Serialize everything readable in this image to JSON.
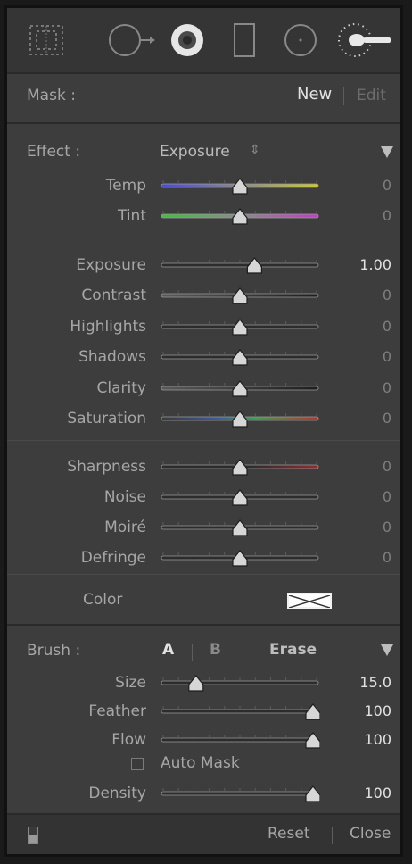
{
  "mask": {
    "label": "Mask :",
    "new_label": "New",
    "edit_label": "Edit"
  },
  "effect": {
    "label": "Effect :",
    "value": "Exposure",
    "arrows": "⇕",
    "sliders": [
      {
        "label": "Temp",
        "value": "0",
        "position": 0.5,
        "track": "temp"
      },
      {
        "label": "Tint",
        "value": "0",
        "position": 0.5,
        "track": "tint"
      }
    ]
  },
  "adjustments": [
    {
      "label": "Exposure",
      "value": "1.00",
      "position": 0.6,
      "track": "grey",
      "active": true
    },
    {
      "label": "Contrast",
      "value": "0",
      "position": 0.5,
      "track": "contrast"
    },
    {
      "label": "Highlights",
      "value": "0",
      "position": 0.5,
      "track": "grey"
    },
    {
      "label": "Shadows",
      "value": "0",
      "position": 0.5,
      "track": "grey"
    },
    {
      "label": "Clarity",
      "value": "0",
      "position": 0.5,
      "track": "contrast"
    },
    {
      "label": "Saturation",
      "value": "0",
      "position": 0.5,
      "track": "saturation"
    }
  ],
  "detail": [
    {
      "label": "Sharpness",
      "value": "0",
      "position": 0.5,
      "track": "sharpness"
    },
    {
      "label": "Noise",
      "value": "0",
      "position": 0.5,
      "track": "grey"
    },
    {
      "label": "Moiré",
      "value": "0",
      "position": 0.5,
      "track": "grey"
    },
    {
      "label": "Defringe",
      "value": "0",
      "position": 0.5,
      "track": "grey"
    }
  ],
  "color": {
    "label": "Color"
  },
  "brush": {
    "label": "Brush :",
    "a_label": "A",
    "b_label": "B",
    "erase_label": "Erase",
    "sliders": [
      {
        "label": "Size",
        "value": "15.0",
        "position": 0.2,
        "track": "grey"
      },
      {
        "label": "Feather",
        "value": "100",
        "position": 1.0,
        "track": "grey"
      },
      {
        "label": "Flow",
        "value": "100",
        "position": 1.0,
        "track": "grey"
      }
    ],
    "auto_mask_label": "Auto Mask",
    "density": {
      "label": "Density",
      "value": "100",
      "position": 1.0,
      "track": "grey"
    }
  },
  "footer": {
    "reset_label": "Reset",
    "close_label": "Close"
  },
  "colors": {
    "panel": "#3d3d3d",
    "accent_text": "#e2e2e2",
    "dim_text": "#7e7e7e"
  },
  "tools": [
    "graduated-filter-icon",
    "spot-removal-icon",
    "red-eye-icon",
    "crop-icon",
    "radial-filter-icon",
    "adjustment-brush-icon"
  ]
}
